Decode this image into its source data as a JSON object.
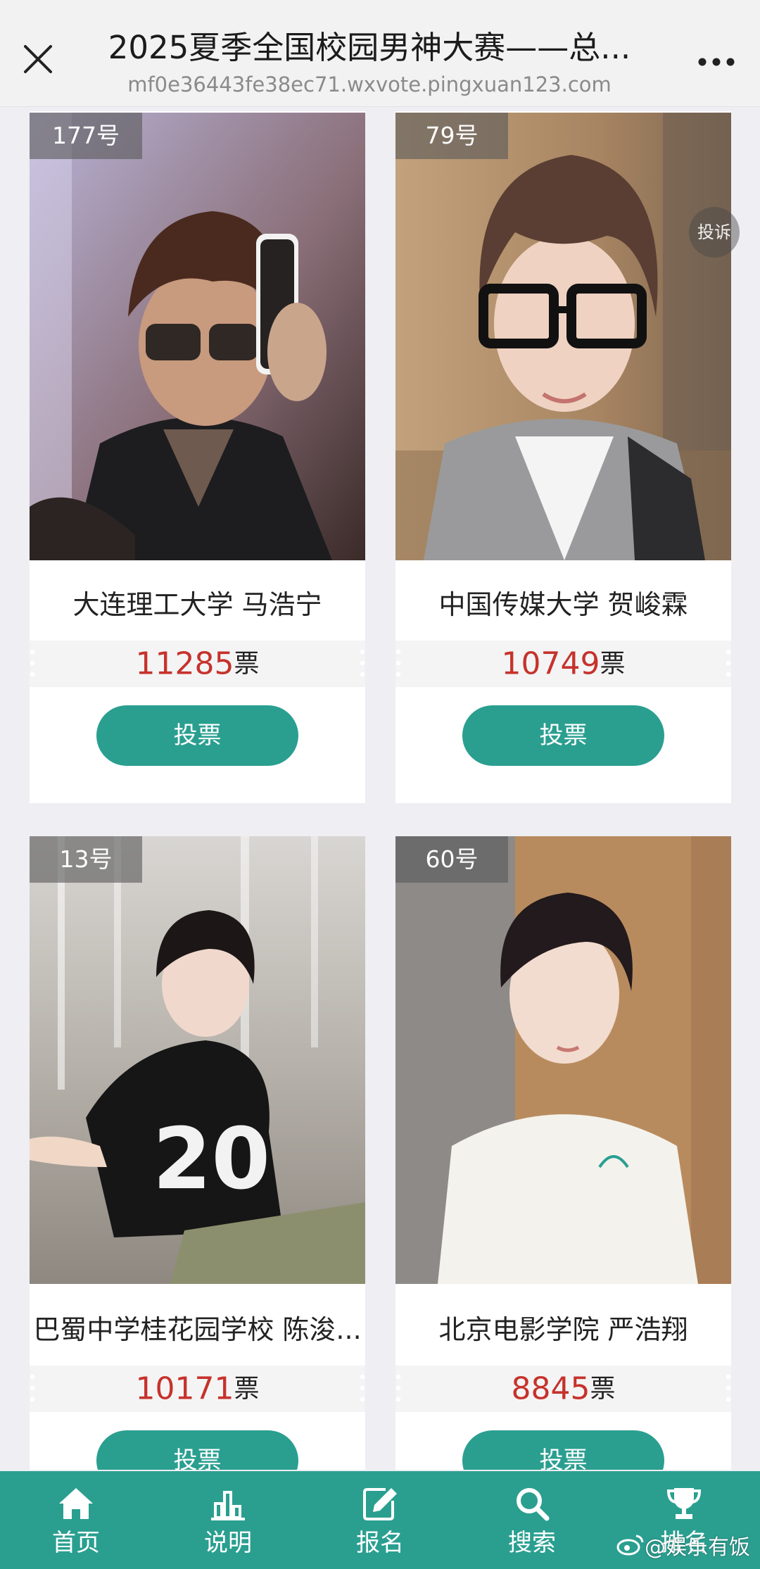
{
  "header": {
    "title": "2025夏季全国校园男神大赛——总...",
    "url": "mf0e36443fe38ec71.wxvote.pingxuan123.com",
    "close_icon": "close-icon",
    "more_icon": "more-dots-icon"
  },
  "candidates": [
    {
      "number": "177号",
      "name": "大连理工大学 马浩宁",
      "votes": "11285",
      "vote_unit": "票",
      "vote_button": "投票"
    },
    {
      "number": "79号",
      "name": "中国传媒大学 贺峻霖",
      "votes": "10749",
      "vote_unit": "票",
      "vote_button": "投票"
    },
    {
      "number": "13号",
      "name": "巴蜀中学桂花园学校 陈浚...",
      "votes": "10171",
      "vote_unit": "票",
      "vote_button": "投票"
    },
    {
      "number": "60号",
      "name": "北京电影学院 严浩翔",
      "votes": "8845",
      "vote_unit": "票",
      "vote_button": "投票"
    }
  ],
  "complain_label": "投诉",
  "nav": [
    {
      "label": "首页",
      "icon": "home-icon"
    },
    {
      "label": "说明",
      "icon": "bar-chart-icon"
    },
    {
      "label": "报名",
      "icon": "edit-icon"
    },
    {
      "label": "搜索",
      "icon": "search-icon"
    },
    {
      "label": "排名",
      "icon": "trophy-icon"
    }
  ],
  "watermark": "@娱乐有饭",
  "colors": {
    "accent": "#2a9f90",
    "vote_count": "#c6322c",
    "background": "#eeeef3"
  }
}
